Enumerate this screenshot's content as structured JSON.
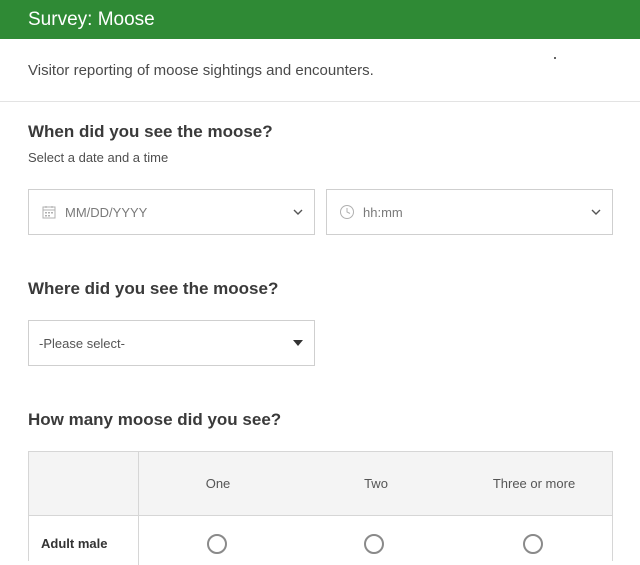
{
  "header": {
    "title": "Survey: Moose"
  },
  "description": "Visitor reporting of moose sightings and encounters.",
  "questions": {
    "when": {
      "title": "When did you see the moose?",
      "hint": "Select a date and a time",
      "date_placeholder": "MM/DD/YYYY",
      "time_placeholder": "hh:mm"
    },
    "where": {
      "title": "Where did you see the moose?",
      "select_value": "-Please select-"
    },
    "how_many": {
      "title": "How many moose did you see?",
      "columns": [
        "One",
        "Two",
        "Three or more"
      ],
      "rows": [
        "Adult male"
      ]
    }
  },
  "colors": {
    "header_bg": "#2f8a35",
    "border": "#cfcfcf"
  }
}
